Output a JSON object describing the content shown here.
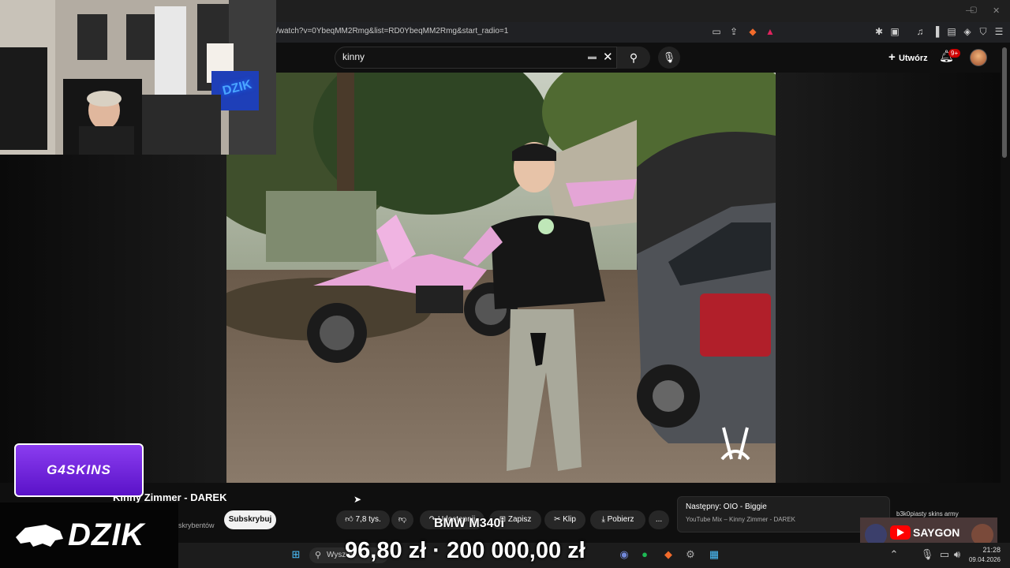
{
  "browser": {
    "url": "/watch?v=0YbeqMM2Rmg&list=RD0YbeqMM2Rmg&start_radio=1"
  },
  "youtube": {
    "search_query": "kinny",
    "create_label": "Utwórz",
    "notifications_badge": "9+"
  },
  "video": {
    "title": "Kinny Zimmer - DAREK",
    "subscribers_fragment": "skrybentów",
    "subscribe_label": "Subskrybuj",
    "likes": "7,8 tys.",
    "share_label": "Udostępnij",
    "save_label": "Zapisz",
    "clip_label": "Klip",
    "download_label": "Pobierz",
    "more_label": "..."
  },
  "up_next": {
    "title": "Następny: OIO - Biggie",
    "subtitle": "YouTube Mix – Kinny Zimmer - DAREK"
  },
  "overlays": {
    "g4skins": "G4SKINS",
    "dzik": "DZIK",
    "saygon": "SAYGON",
    "ticker": "b3k0piasty skins army",
    "bmw": "BMW M340i",
    "price_text": "96,80 zł · 200 000,00 zł"
  },
  "taskbar": {
    "search_placeholder": "Wyszuk",
    "time": "21:28",
    "date": "09.04.2026"
  }
}
